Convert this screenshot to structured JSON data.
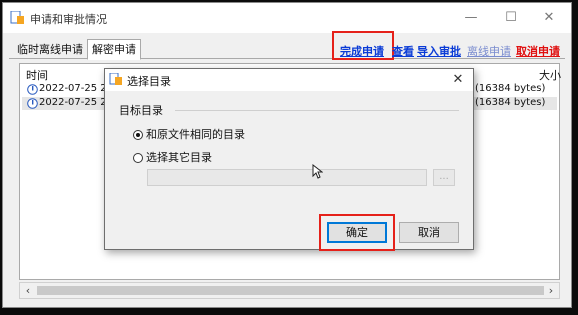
{
  "window": {
    "title": "申请和审批情况",
    "controls": {
      "minimize": "—",
      "maximize": "☐",
      "close": "✕"
    }
  },
  "tabs": [
    {
      "label": "临时离线申请",
      "active": false
    },
    {
      "label": "解密申请",
      "active": true
    }
  ],
  "actions": {
    "complete": "完成申请",
    "view": "查看",
    "import_approval": "导入审批",
    "offline_apply": "离线申请",
    "cancel_apply": "取消申请"
  },
  "list": {
    "columns": {
      "time": "时间",
      "size": "大小"
    },
    "rows": [
      {
        "time": "2022-07-25 20:",
        "size": "(16384 bytes)",
        "icon": "info-clock-icon"
      },
      {
        "time": "2022-07-25 20:",
        "size": "(16384 bytes)",
        "icon": "info-clock-icon",
        "selected": true
      }
    ]
  },
  "dialog": {
    "title": "选择目录",
    "group_label": "目标目录",
    "option_same": "和原文件相同的目录",
    "option_other": "选择其它目录",
    "browse_label": "...",
    "ok_label": "确定",
    "cancel_label": "取消",
    "close": "✕"
  },
  "colors": {
    "link_blue": "#0a3bd6",
    "link_red": "#e01010",
    "highlight_red": "#e5211a"
  }
}
